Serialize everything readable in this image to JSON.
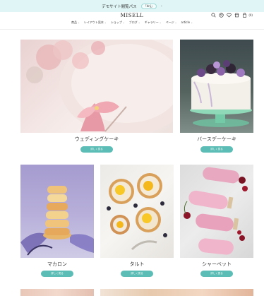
{
  "topbar": {
    "text": "デモサイト閲覧パス",
    "badge": "「dnj」",
    "chevron": "›"
  },
  "header": {
    "logo": "MISELL",
    "cart_count": "(0)"
  },
  "nav": {
    "items": [
      {
        "label": "商品"
      },
      {
        "label": "レイアウト見本"
      },
      {
        "label": "ショップ"
      },
      {
        "label": "ブログ"
      },
      {
        "label": "ギャラリー"
      },
      {
        "label": "ページ"
      },
      {
        "label": "article"
      }
    ]
  },
  "products": [
    {
      "title": "ウェディングケーキ",
      "button": "詳しく見る",
      "image_icon": "wedding-cake-image"
    },
    {
      "title": "バースデーケーキ",
      "button": "詳しく見る",
      "image_icon": "birthday-cake-image"
    },
    {
      "title": "マカロン",
      "button": "詳しく見る",
      "image_icon": "macaron-image"
    },
    {
      "title": "タルト",
      "button": "詳しく見る",
      "image_icon": "tart-image"
    },
    {
      "title": "シャーベット",
      "button": "詳しく見る",
      "image_icon": "sherbet-image"
    }
  ],
  "colors": {
    "accent": "#5bbdb5",
    "topbar_bg": "#e0f6f6"
  }
}
